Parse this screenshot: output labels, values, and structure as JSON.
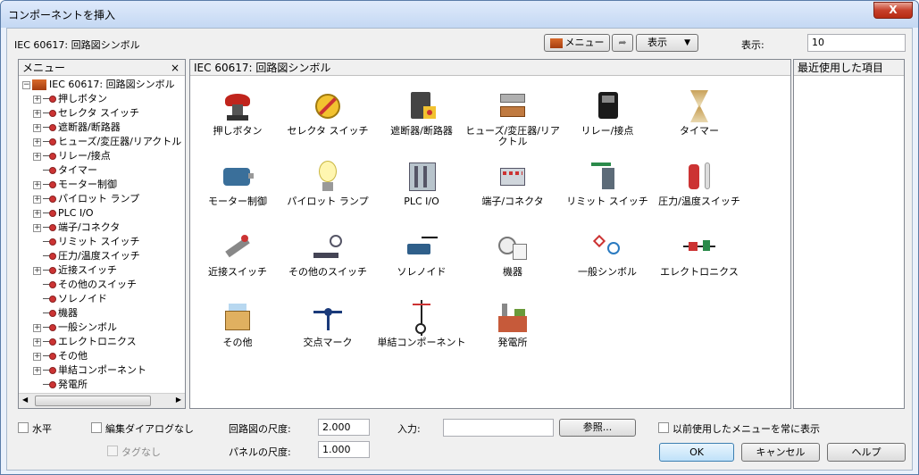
{
  "window": {
    "title": "コンポーネントを挿入",
    "close": "X"
  },
  "toolbar": {
    "library_label": "IEC 60617: 回路図シンボル",
    "menu_button": "メニュー",
    "display_button": "表示",
    "display_count_label": "表示:",
    "display_count_value": "10"
  },
  "menu_panel": {
    "title": "メニュー",
    "close": "×",
    "root": "IEC 60617: 回路図シンボル",
    "items": [
      {
        "label": "押しボタン",
        "expandable": true
      },
      {
        "label": "セレクタ スイッチ",
        "expandable": true
      },
      {
        "label": "遮断器/断路器",
        "expandable": true
      },
      {
        "label": "ヒューズ/変圧器/リアクトル",
        "expandable": true
      },
      {
        "label": "リレー/接点",
        "expandable": true
      },
      {
        "label": "タイマー",
        "expandable": false
      },
      {
        "label": "モーター制御",
        "expandable": true
      },
      {
        "label": "パイロット ランプ",
        "expandable": true
      },
      {
        "label": "PLC I/O",
        "expandable": true
      },
      {
        "label": "端子/コネクタ",
        "expandable": true
      },
      {
        "label": "リミット スイッチ",
        "expandable": false
      },
      {
        "label": "圧力/温度スイッチ",
        "expandable": false
      },
      {
        "label": "近接スイッチ",
        "expandable": true
      },
      {
        "label": "その他のスイッチ",
        "expandable": false
      },
      {
        "label": "ソレノイド",
        "expandable": false
      },
      {
        "label": "機器",
        "expandable": false
      },
      {
        "label": "一般シンボル",
        "expandable": true
      },
      {
        "label": "エレクトロニクス",
        "expandable": true
      },
      {
        "label": "その他",
        "expandable": true
      },
      {
        "label": "単結コンポーネント",
        "expandable": true
      },
      {
        "label": "発電所",
        "expandable": false
      }
    ]
  },
  "main_panel": {
    "title": "IEC 60617: 回路図シンボル",
    "items": [
      {
        "label": "押しボタン",
        "icon": "push-button-icon"
      },
      {
        "label": "セレクタ スイッチ",
        "icon": "selector-switch-icon"
      },
      {
        "label": "遮断器/断路器",
        "icon": "breaker-icon"
      },
      {
        "label": "ヒューズ/変圧器/リア\nクトル",
        "icon": "fuse-icon"
      },
      {
        "label": "リレー/接点",
        "icon": "relay-icon"
      },
      {
        "label": "タイマー",
        "icon": "timer-icon"
      },
      {
        "label": "モーター制御",
        "icon": "motor-icon"
      },
      {
        "label": "パイロット ランプ",
        "icon": "lamp-icon"
      },
      {
        "label": "PLC I/O",
        "icon": "plc-icon"
      },
      {
        "label": "端子/コネクタ",
        "icon": "terminal-icon"
      },
      {
        "label": "リミット スイッチ",
        "icon": "limit-switch-icon"
      },
      {
        "label": "圧力/温度スイッチ",
        "icon": "pressure-switch-icon"
      },
      {
        "label": "近接スイッチ",
        "icon": "proximity-switch-icon"
      },
      {
        "label": "その他のスイッチ",
        "icon": "other-switch-icon"
      },
      {
        "label": "ソレノイド",
        "icon": "solenoid-icon"
      },
      {
        "label": "機器",
        "icon": "instrument-icon"
      },
      {
        "label": "一般シンボル",
        "icon": "general-symbol-icon"
      },
      {
        "label": "エレクトロニクス",
        "icon": "electronics-icon"
      },
      {
        "label": "その他",
        "icon": "misc-box-icon"
      },
      {
        "label": "交点マーク",
        "icon": "junction-icon"
      },
      {
        "label": "単結コンポーネント",
        "icon": "single-line-icon"
      },
      {
        "label": "発電所",
        "icon": "power-plant-icon"
      }
    ]
  },
  "recent_panel": {
    "title": "最近使用した項目"
  },
  "options": {
    "horizontal": "水平",
    "no_edit_dialog": "編集ダイアログなし",
    "no_tag": "タグなし",
    "schematic_scale_label": "回路図の尺度:",
    "schematic_scale_value": "2.000",
    "panel_scale_label": "パネルの尺度:",
    "panel_scale_value": "1.000",
    "input_label": "入力:",
    "input_value": "",
    "browse_button": "参照...",
    "always_show_prev_menu": "以前使用したメニューを常に表示",
    "ok_button": "OK",
    "cancel_button": "キャンセル",
    "help_button": "ヘルプ"
  }
}
